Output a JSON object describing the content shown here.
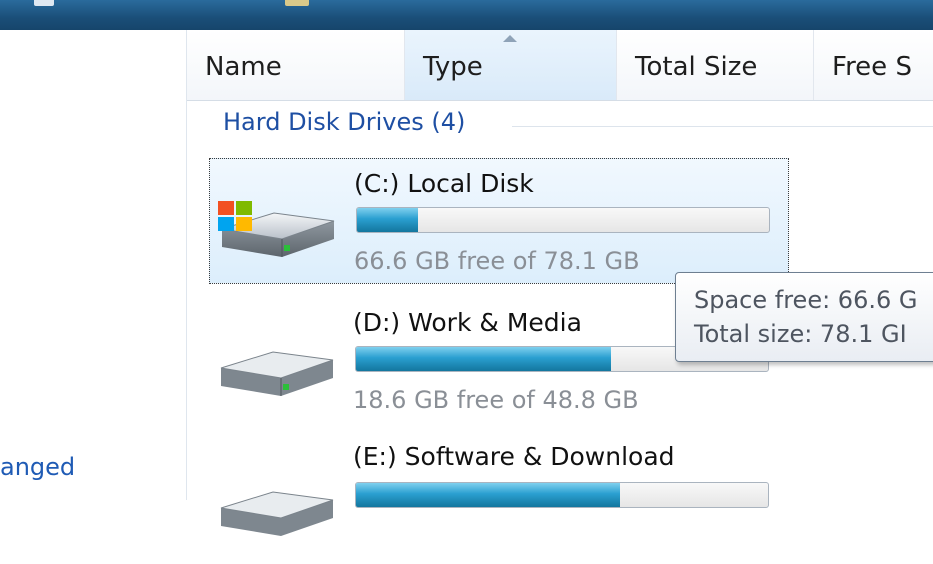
{
  "columns": [
    {
      "label": "Name",
      "sorted": false
    },
    {
      "label": "Type",
      "sorted": true
    },
    {
      "label": "Total Size",
      "sorted": false
    },
    {
      "label": "Free S",
      "sorted": false
    }
  ],
  "sort_icon": "sort-up-arrow-icon",
  "nav": {
    "partial_link": "anged"
  },
  "group": {
    "title": "Hard Disk Drives (4)"
  },
  "drives": [
    {
      "name": "(C:) Local Disk",
      "free_text": "66.6 GB free of 78.1 GB",
      "used_fraction": 0.147,
      "selected": true,
      "icon": "windows-system-drive-icon"
    },
    {
      "name": "(D:) Work & Media",
      "free_text": "18.6 GB free of 48.8 GB",
      "used_fraction": 0.619,
      "selected": false,
      "icon": "hard-drive-icon"
    },
    {
      "name": "(E:) Software & Download",
      "free_text": "",
      "used_fraction": 0.64,
      "selected": false,
      "icon": "hard-drive-icon"
    }
  ],
  "tooltip": {
    "line1": "Space free: 66.6 G",
    "line2": "Total size: 78.1 GI"
  },
  "colors": {
    "accent_link": "#1f5bb5",
    "group_title": "#1e4fa3",
    "bar_fill": "#2a9fd0",
    "titlebar": "#1a4e78"
  }
}
